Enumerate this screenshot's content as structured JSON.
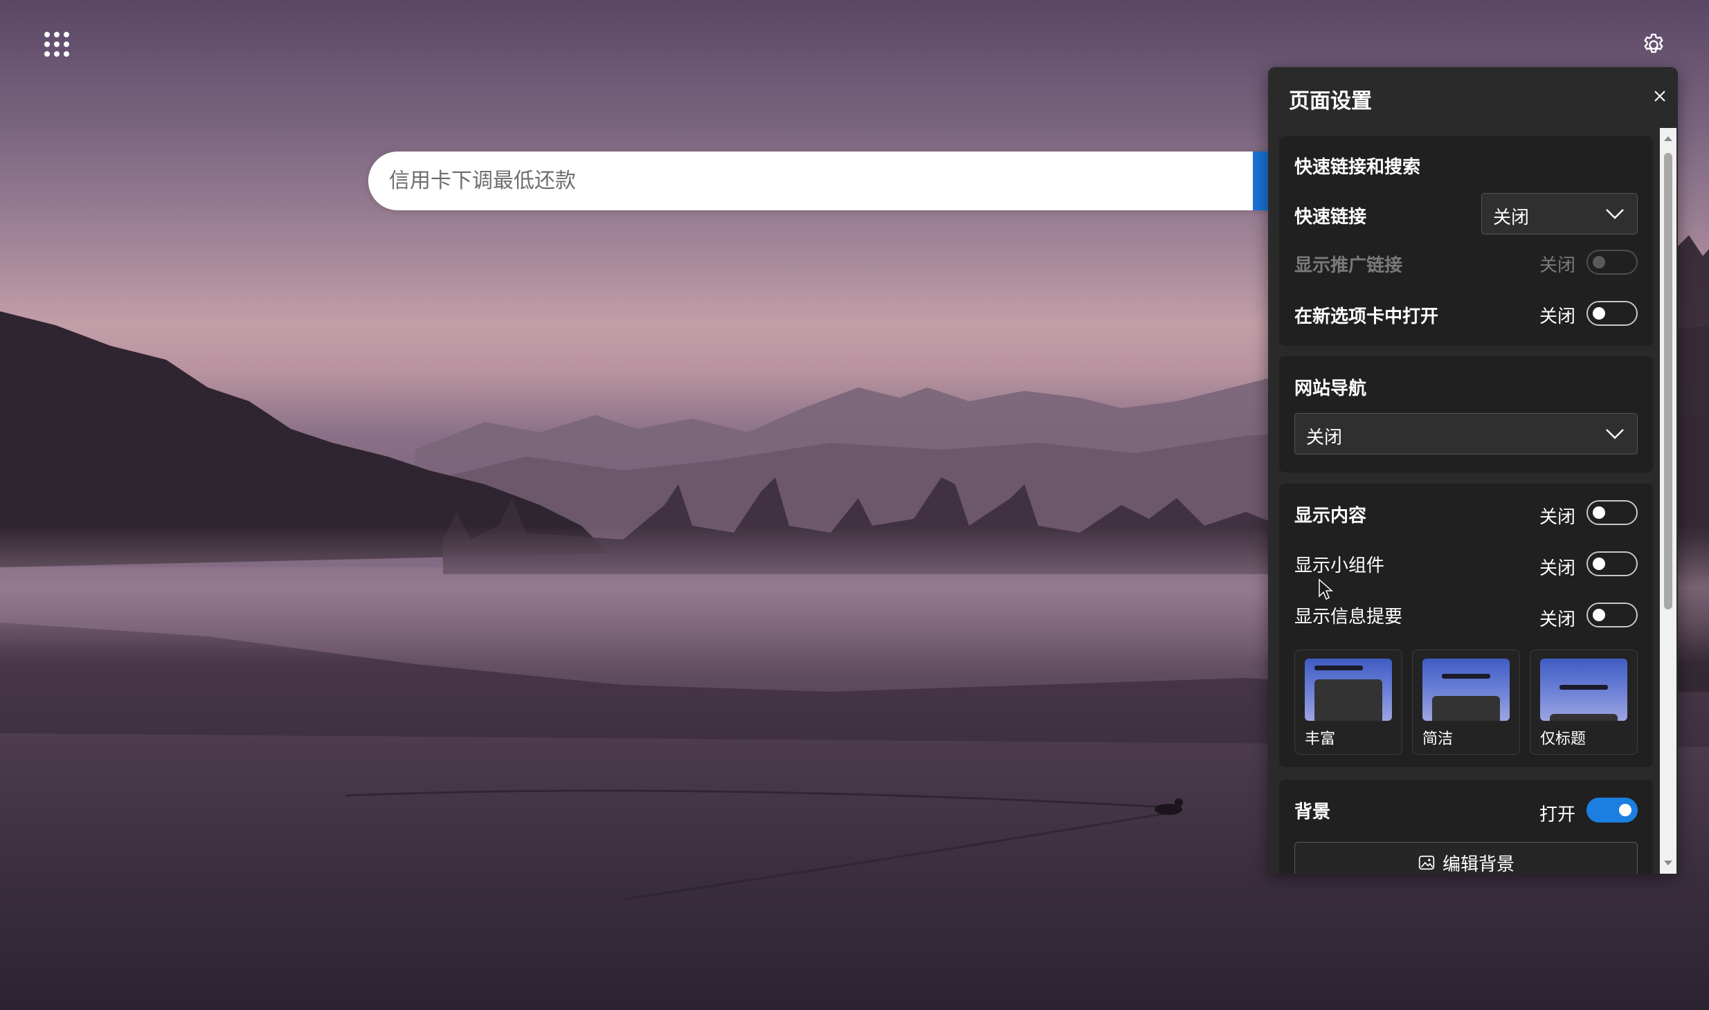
{
  "search": {
    "placeholder": "信用卡下调最低还款"
  },
  "icons": {
    "apps": "grid-dots-icon",
    "settings": "gear-icon",
    "close": "close-icon",
    "chevron": "chevron-down-icon",
    "image": "image-icon"
  },
  "colors": {
    "accent": "#1a7fe0",
    "panel_bg": "#2a2a2a",
    "card_bg": "#202020"
  },
  "panel": {
    "title": "页面设置",
    "quick_links_section": {
      "title": "快速链接和搜索",
      "quick_links": {
        "label": "快速链接",
        "value": "关闭"
      },
      "show_promoted": {
        "label": "显示推广链接",
        "state": "关闭",
        "on": false,
        "disabled": true
      },
      "open_new_tab": {
        "label": "在新选项卡中打开",
        "state": "关闭",
        "on": false
      }
    },
    "site_nav_section": {
      "title": "网站导航",
      "value": "关闭"
    },
    "content_section": {
      "title": "显示内容",
      "state": "关闭",
      "widgets": {
        "label": "显示小组件",
        "state": "关闭"
      },
      "feed": {
        "label": "显示信息提要",
        "state": "关闭"
      },
      "layouts": [
        {
          "label": "丰富"
        },
        {
          "label": "简洁"
        },
        {
          "label": "仅标题"
        }
      ]
    },
    "background_section": {
      "title": "背景",
      "state": "打开",
      "on": true,
      "edit_button": "编辑背景"
    }
  }
}
